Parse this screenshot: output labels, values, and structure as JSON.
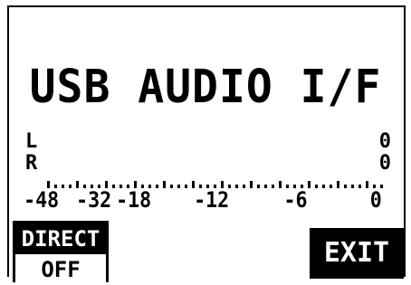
{
  "screen": {
    "title": "USB AUDIO I/F"
  },
  "meter": {
    "channels": [
      {
        "label": "L",
        "value": "0"
      },
      {
        "label": "R",
        "value": "0"
      }
    ],
    "scale_labels": [
      "-48",
      "-32",
      "-18",
      "-12",
      "-6",
      "0"
    ]
  },
  "direct_button": {
    "label": "DIRECT",
    "state": "OFF"
  },
  "exit_button": {
    "label": "EXIT"
  },
  "colors": {
    "foreground": "#000000",
    "background": "#ffffff"
  }
}
